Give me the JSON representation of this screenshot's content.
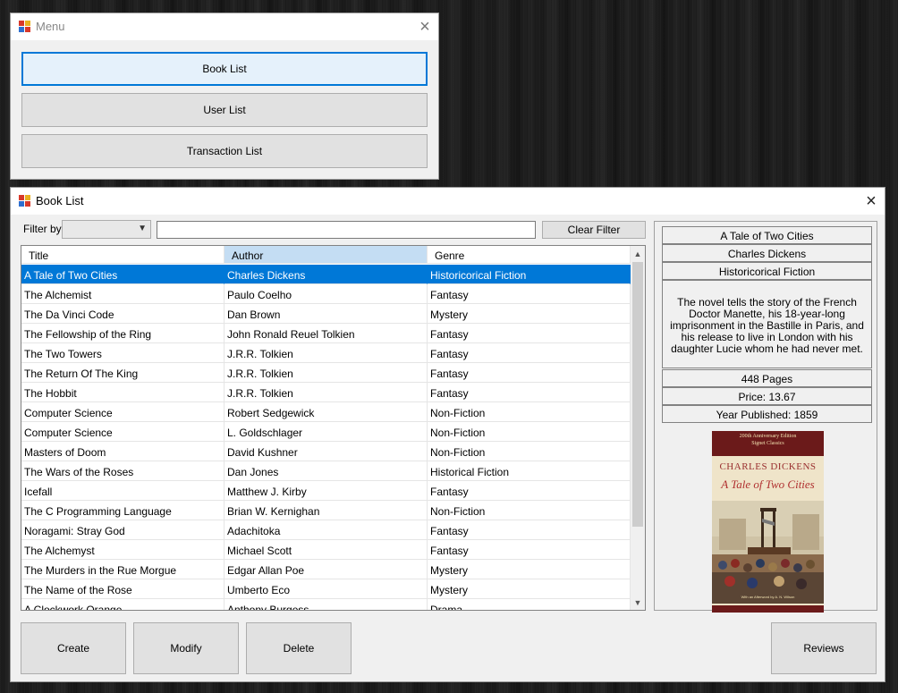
{
  "menu_window": {
    "title": "Menu",
    "buttons": {
      "book_list": "Book List",
      "user_list": "User List",
      "transaction_list": "Transaction List"
    }
  },
  "book_window": {
    "title": "Book List",
    "filter": {
      "label": "Filter by",
      "selected": "",
      "text": "",
      "clear_button": "Clear Filter"
    },
    "table": {
      "columns": [
        "Title",
        "Author",
        "Genre"
      ],
      "rows": [
        [
          "A Tale of Two Cities",
          "Charles Dickens",
          "Historicorical Fiction"
        ],
        [
          "The Alchemist",
          "Paulo Coelho",
          "Fantasy"
        ],
        [
          "The Da Vinci Code",
          "Dan Brown",
          "Mystery"
        ],
        [
          "The Fellowship of the Ring",
          "John Ronald Reuel Tolkien",
          "Fantasy"
        ],
        [
          "The Two Towers",
          "J.R.R. Tolkien",
          "Fantasy"
        ],
        [
          "The Return Of The King",
          "J.R.R. Tolkien",
          "Fantasy"
        ],
        [
          "The Hobbit",
          "J.R.R. Tolkien",
          "Fantasy"
        ],
        [
          "Computer Science",
          "Robert Sedgewick",
          "Non-Fiction"
        ],
        [
          "Computer Science",
          "L. Goldschlager",
          "Non-Fiction"
        ],
        [
          "Masters of Doom",
          "David Kushner",
          "Non-Fiction"
        ],
        [
          "The Wars of the Roses",
          "Dan Jones",
          "Historical Fiction"
        ],
        [
          "Icefall",
          "Matthew J. Kirby",
          "Fantasy"
        ],
        [
          "The C Programming Language",
          "Brian W. Kernighan",
          "Non-Fiction"
        ],
        [
          "Noragami: Stray God",
          "Adachitoka",
          "Fantasy"
        ],
        [
          "The Alchemyst",
          "Michael Scott",
          "Fantasy"
        ],
        [
          "The Murders in the Rue Morgue",
          "Edgar Allan Poe",
          "Mystery"
        ],
        [
          "The Name of the Rose",
          "Umberto Eco",
          "Mystery"
        ],
        [
          "A Clockwork Orange",
          "Anthony Burgess",
          "Drama"
        ]
      ]
    },
    "details": {
      "title": "A Tale of Two Cities",
      "author": "Charles Dickens",
      "genre": "Historicorical Fiction",
      "description": "The novel tells the story of the French Doctor Manette, his 18-year-long imprisonment in the Bastille in Paris, and his release to live in London with his daughter Lucie whom he had never met.",
      "pages": "448 Pages",
      "price": "Price: 13.67",
      "year": "Year Published: 1859",
      "cover": {
        "edition": "200th Anniversary Edition",
        "series": "Signet Classics",
        "author": "CHARLES DICKENS",
        "title": "A Tale of Two Cities",
        "afterword": "With an Afterword by A. N. Wilson"
      }
    },
    "buttons": {
      "create": "Create",
      "modify": "Modify",
      "delete": "Delete",
      "reviews": "Reviews"
    }
  },
  "colors": {
    "accent": "#0078d7",
    "header_selected": "#c4ddf3",
    "window_bg": "#f0f0f0"
  }
}
